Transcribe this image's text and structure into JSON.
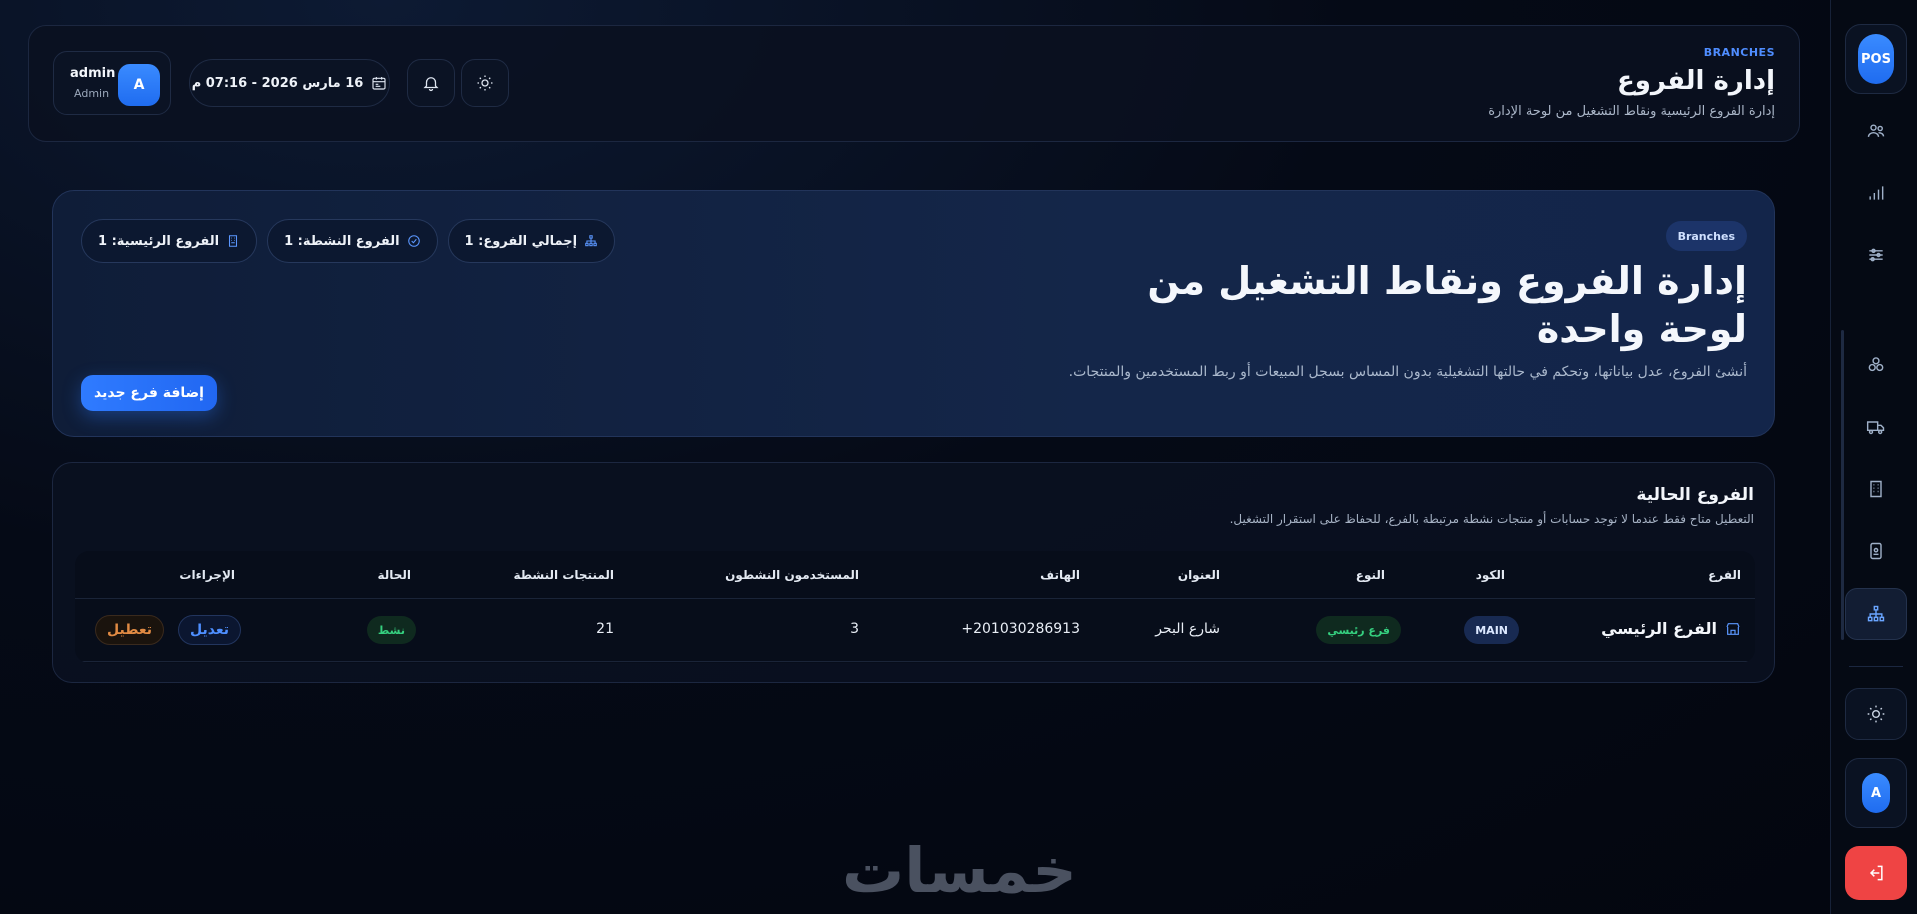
{
  "sidebar": {
    "logo_text": "POS",
    "avatar_initial": "A",
    "items": [
      "users-icon",
      "chart-icon",
      "sliders-icon",
      "boxes-icon",
      "truck-icon",
      "building-icon",
      "badge-icon",
      "branches-icon"
    ]
  },
  "header": {
    "eyebrow": "BRANCHES",
    "title": "إدارة الفروع",
    "subtitle": "إدارة الفروع الرئيسية ونقاط التشغيل من لوحة الإدارة",
    "user_name": "admin",
    "user_role": "Admin",
    "user_initial": "A",
    "datetime": "16 مارس 2026 - 07:16 م"
  },
  "hero": {
    "badge": "Branches",
    "title": "إدارة الفروع ونقاط التشغيل من لوحة واحدة",
    "description": "أنشئ الفروع، عدل بياناتها، وتحكم في حالتها التشغيلية بدون المساس بسجل المبيعات أو ربط المستخدمين والمنتجات.",
    "stats": {
      "main": "الفروع الرئيسية: 1",
      "active": "الفروع النشطة: 1",
      "total": "إجمالي الفروع: 1"
    },
    "add_button": "إضافة فرع جديد"
  },
  "table": {
    "title": "الفروع الحالية",
    "subtitle": "التعطيل متاح فقط عندما لا توجد حسابات أو منتجات نشطة مرتبطة بالفرع، للحفاظ على استقرار التشغيل.",
    "headers": {
      "branch": "الفرع",
      "code": "الكود",
      "type": "النوع",
      "address": "العنوان",
      "phone": "الهاتف",
      "active_users": "المستخدمون النشطون",
      "active_products": "المنتجات النشطة",
      "status": "الحالة",
      "actions": "الإجراءات"
    },
    "rows": [
      {
        "branch": "الفرع الرئيسي",
        "code": "MAIN",
        "type": "فرع رئيسي",
        "address": "شارع البحر",
        "phone": "+201030286913",
        "active_users": "3",
        "active_products": "21",
        "status": "نشط",
        "edit": "تعديل",
        "disable": "تعطيل"
      }
    ]
  },
  "watermark": "خمسات",
  "colors": {
    "accent": "#2f7bff",
    "success": "#35d07f",
    "warning": "#e08a43",
    "danger": "#ef4444"
  }
}
